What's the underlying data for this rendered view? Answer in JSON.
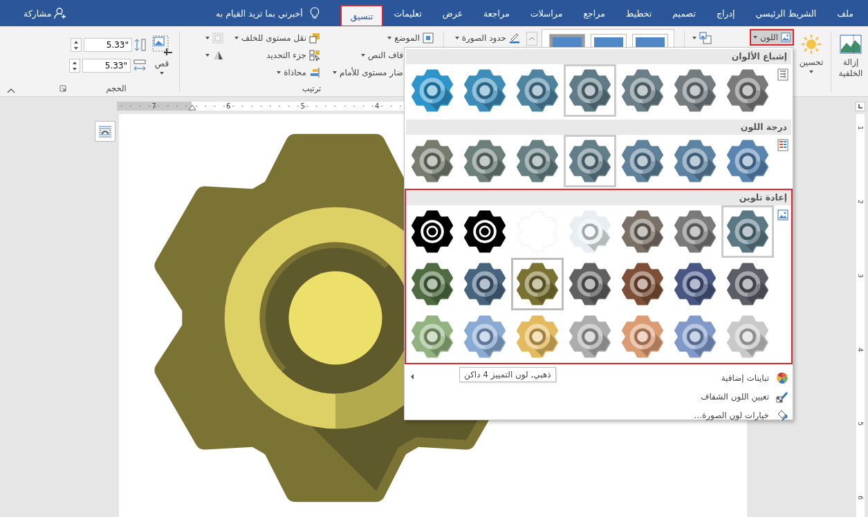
{
  "tabs": [
    {
      "label": "ملف",
      "selected": false
    },
    {
      "label": "الشريط الرئيسي",
      "selected": false
    },
    {
      "label": "إدراج",
      "selected": false
    },
    {
      "label": "تصميم",
      "selected": false
    },
    {
      "label": "تخطيط",
      "selected": false
    },
    {
      "label": "مراجع",
      "selected": false
    },
    {
      "label": "مراسلات",
      "selected": false
    },
    {
      "label": "مراجعة",
      "selected": false
    },
    {
      "label": "عرض",
      "selected": false
    },
    {
      "label": "تعليمات",
      "selected": false
    },
    {
      "label": "تنسيق",
      "selected": true
    }
  ],
  "tell_me": {
    "placeholder": "أخبرني بما تريد القيام به"
  },
  "share": {
    "label": "مشاركة"
  },
  "ribbon": {
    "remove_background": "إزالة الخلفية",
    "corrections": "تحسين",
    "color": {
      "label": "اللون",
      "pressed": true
    },
    "picture_border": "حدود الصورة",
    "position": "الموضع",
    "wrap_text": "فاف النص",
    "bring_forward": "ضار مستوى للأمام",
    "send_backward": "نقل مستوى للخلف",
    "selection_pane": "جزء التحديد",
    "align": "محاذاة",
    "arrange_label": "ترتيب",
    "crop": "قص",
    "height": "5.33\"",
    "width": "5.33\"",
    "size_label": "الحجم"
  },
  "ruler": {
    "horizontal": [
      "4",
      "5",
      "6",
      "7"
    ],
    "vertical": [
      "1",
      "2",
      "3",
      "4",
      "5",
      "6"
    ]
  },
  "color_menu": {
    "sections": [
      {
        "title": "إشباع الألوان",
        "kind": "saturation",
        "outlined": false,
        "options": [
          {
            "kind": "gear",
            "color": "#7a7a7a",
            "selected": false
          },
          {
            "kind": "gear",
            "color": "#747c80",
            "selected": false
          },
          {
            "kind": "gear",
            "color": "#6b7f88",
            "selected": false
          },
          {
            "kind": "gear",
            "color": "#5f7b87",
            "selected": true
          },
          {
            "kind": "gear",
            "color": "#4f84a0",
            "selected": false
          },
          {
            "kind": "gear",
            "color": "#3c8db8",
            "selected": false
          },
          {
            "kind": "gear",
            "color": "#2e95cb",
            "selected": false
          }
        ]
      },
      {
        "title": "درجة اللون",
        "kind": "tone",
        "outlined": false,
        "options": [
          {
            "kind": "gear",
            "color": "#5a85b0",
            "selected": false
          },
          {
            "kind": "gear",
            "color": "#5d83a2",
            "selected": false
          },
          {
            "kind": "gear",
            "color": "#60819a",
            "selected": false
          },
          {
            "kind": "gear",
            "color": "#627e88",
            "selected": true
          },
          {
            "kind": "gear",
            "color": "#678083",
            "selected": false
          },
          {
            "kind": "gear",
            "color": "#6d7f7a",
            "selected": false
          },
          {
            "kind": "gear",
            "color": "#767c6e",
            "selected": false
          }
        ]
      },
      {
        "title": "إعادة تلوين",
        "kind": "recolor",
        "outlined": true,
        "options": [
          {
            "kind": "gear",
            "color": "#5b7985",
            "selected": true,
            "hovered": false
          },
          {
            "kind": "gear",
            "color": "#7a7a7a",
            "selected": false,
            "hovered": false
          },
          {
            "kind": "gear",
            "color": "#7a7066",
            "selected": false,
            "hovered": false
          },
          {
            "kind": "gear",
            "color": "#e8eef2",
            "selected": false,
            "hovered": false
          },
          {
            "kind": "outline",
            "color": "#ffffff",
            "selected": false,
            "hovered": false
          },
          {
            "kind": "mono",
            "color": "#000000",
            "selected": false,
            "hovered": false
          },
          {
            "kind": "mono",
            "color": "#000000",
            "selected": false,
            "hovered": false
          },
          {
            "kind": "gear",
            "color": "#5b5e67",
            "selected": false,
            "hovered": false
          },
          {
            "kind": "gear",
            "color": "#485683",
            "selected": false,
            "hovered": false
          },
          {
            "kind": "gear",
            "color": "#7c4f36",
            "selected": false,
            "hovered": false
          },
          {
            "kind": "gear",
            "color": "#606060",
            "selected": false,
            "hovered": false
          },
          {
            "kind": "gear",
            "color": "#7a7232",
            "selected": false,
            "hovered": true
          },
          {
            "kind": "gear",
            "color": "#47647f",
            "selected": false,
            "hovered": false
          },
          {
            "kind": "gear",
            "color": "#4e6c40",
            "selected": false,
            "hovered": false
          },
          {
            "kind": "gear",
            "color": "#c9c9c9",
            "selected": false,
            "hovered": false
          },
          {
            "kind": "gear",
            "color": "#8099c8",
            "selected": false,
            "hovered": false
          },
          {
            "kind": "gear",
            "color": "#db9c74",
            "selected": false,
            "hovered": false
          },
          {
            "kind": "gear",
            "color": "#adadad",
            "selected": false,
            "hovered": false
          },
          {
            "kind": "gear",
            "color": "#e3ba5e",
            "selected": false,
            "hovered": false
          },
          {
            "kind": "gear",
            "color": "#89aad2",
            "selected": false,
            "hovered": false
          },
          {
            "kind": "gear",
            "color": "#92b27f",
            "selected": false,
            "hovered": false
          }
        ]
      }
    ],
    "tooltip": "ذهبي, لون التمييز 4 داكن",
    "items": [
      {
        "kind": "variations",
        "label": "تباينات إضافية"
      },
      {
        "kind": "transparent",
        "label": "تعيين اللون الشفاف"
      },
      {
        "kind": "options",
        "label": "خيارات لون الصورة..."
      }
    ]
  }
}
